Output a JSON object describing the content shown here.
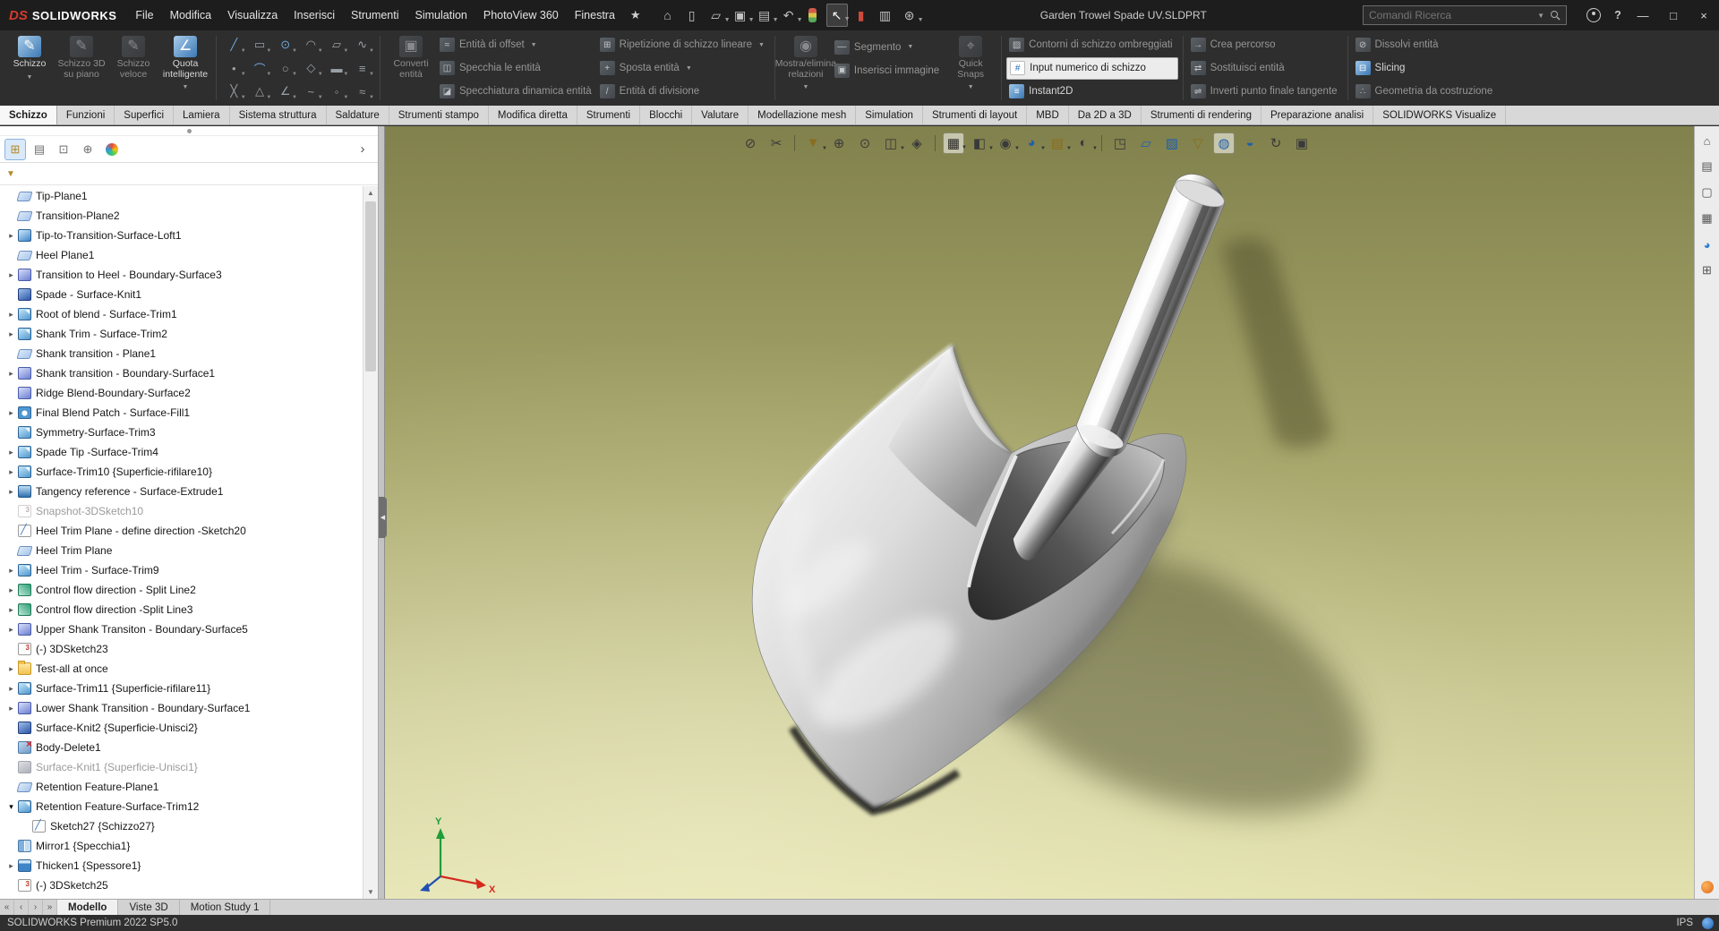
{
  "titlebar": {
    "logo_mark": "DS",
    "app_name": "SOLIDWORKS",
    "menus": [
      "File",
      "Modifica",
      "Visualizza",
      "Inserisci",
      "Strumenti",
      "Simulation",
      "PhotoView 360",
      "Finestra"
    ],
    "quick_icons": [
      {
        "name": "home-icon",
        "glyph": "⌂"
      },
      {
        "name": "new-document-icon",
        "glyph": "▯"
      },
      {
        "name": "open-icon",
        "glyph": "▱",
        "caret": true
      },
      {
        "name": "save-icon",
        "glyph": "▣",
        "caret": true
      },
      {
        "name": "print-icon",
        "glyph": "▤",
        "caret": true
      },
      {
        "name": "undo-icon",
        "glyph": "↶",
        "caret": true
      },
      {
        "name": "rebuild-icon",
        "glyph": "",
        "rebuild": true
      },
      {
        "name": "select-arrow-icon",
        "glyph": "↖",
        "pressed": true,
        "caret": true
      },
      {
        "name": "mate-icon",
        "glyph": "▮",
        "tone": "red"
      },
      {
        "name": "evaluate-icon",
        "glyph": "▥"
      },
      {
        "name": "options-gear-icon",
        "glyph": "⊛",
        "caret": true
      }
    ],
    "document_title": "Garden Trowel Spade UV.SLDPRT",
    "search_placeholder": "Comandi Ricerca",
    "window_buttons": {
      "minimize": "—",
      "maximize": "□",
      "close": "×"
    }
  },
  "ribbon": {
    "left_bigs": [
      {
        "label": "Schizzo",
        "name": "sketch-button",
        "icon_glyph": "✎",
        "state": "enabled",
        "caret": true
      },
      {
        "label": "Schizzo 3D su piano",
        "name": "sketch3d-on-plane-button",
        "icon_glyph": "✎",
        "state": "disabled"
      },
      {
        "label": "Schizzo veloce",
        "name": "rapid-sketch-button",
        "icon_glyph": "✎",
        "state": "disabled"
      },
      {
        "label": "Quota intelligente",
        "name": "smart-dimension-button",
        "icon_glyph": "∠",
        "state": "enabled",
        "caret": true
      }
    ],
    "sketch_tools": [
      {
        "name": "line-tool",
        "glyph": "╱",
        "tone": "blue",
        "caret": true
      },
      {
        "name": "corner-rectangle-tool",
        "glyph": "▭",
        "caret": true
      },
      {
        "name": "circle-tool",
        "glyph": "⊙",
        "tone": "blue",
        "caret": true
      },
      {
        "name": "centerpoint-arc-tool",
        "glyph": "◠",
        "caret": true
      },
      {
        "name": "polygon-tool",
        "glyph": "▱",
        "caret": true
      },
      {
        "name": "spline-tool",
        "glyph": "∿",
        "caret": true
      },
      {
        "name": "point-tool",
        "glyph": "•",
        "caret": true
      },
      {
        "name": "three-point-arc-tool",
        "glyph": "⌒",
        "tone": "blue",
        "caret": true
      },
      {
        "name": "ellipse-tool",
        "glyph": "○",
        "caret": true
      },
      {
        "name": "sketch-fillet-tool",
        "glyph": "◇",
        "caret": true
      },
      {
        "name": "straight-slot-tool",
        "glyph": "▬",
        "caret": true
      },
      {
        "name": "sketch-text-tool",
        "glyph": "≡",
        "caret": true
      },
      {
        "name": "centerline-tool",
        "glyph": "╳",
        "caret": true
      },
      {
        "name": "trim-tool",
        "glyph": "△",
        "caret": true
      },
      {
        "name": "extend-tool",
        "glyph": "∠",
        "caret": true
      },
      {
        "name": "construction-tool",
        "glyph": "~",
        "caret": true
      },
      {
        "name": "snap-tool",
        "glyph": "◦",
        "caret": true
      },
      {
        "name": "grid-tool",
        "glyph": "≈",
        "caret": true
      }
    ],
    "convert_bigs": [
      {
        "label": "Converti entità",
        "name": "convert-entities-button",
        "icon_glyph": "▣",
        "state": "disabled"
      }
    ],
    "col_a": [
      {
        "label": "Entità di offset",
        "name": "offset-entities-row",
        "glyph": "≈",
        "state": "disabled",
        "caret": true
      },
      {
        "label": "Specchia le entità",
        "name": "mirror-entities-row",
        "glyph": "◫",
        "state": "disabled"
      },
      {
        "label": "Specchiatura dinamica entità",
        "name": "dynamic-mirror-row",
        "glyph": "◪",
        "state": "disabled"
      }
    ],
    "col_b": [
      {
        "label": "Ripetizione di schizzo lineare",
        "name": "linear-sketch-pattern-row",
        "glyph": "⊞",
        "state": "disabled",
        "caret": true
      },
      {
        "label": "Sposta entità",
        "name": "move-entities-row",
        "glyph": "+",
        "state": "disabled",
        "caret": true
      },
      {
        "label": "Entità di divisione",
        "name": "split-entities-row",
        "glyph": "/",
        "state": "disabled"
      }
    ],
    "show_bigs": [
      {
        "label": "Mostra/elimina relazioni",
        "name": "display-delete-relations-button",
        "icon_glyph": "◉",
        "state": "disabled",
        "caret": true
      }
    ],
    "col_c": [
      {
        "label": "Segmento",
        "name": "segment-row",
        "glyph": "—",
        "state": "disabled",
        "caret": true
      },
      {
        "label": "Inserisci immagine",
        "name": "insert-image-row",
        "glyph": "▣",
        "state": "disabled"
      }
    ],
    "snap_bigs": [
      {
        "label": "Quick Snaps",
        "name": "quick-snaps-button",
        "icon_glyph": "⌖",
        "state": "disabled",
        "caret": true
      }
    ],
    "col_d": [
      {
        "label": "Contorni di schizzo ombreggiati",
        "name": "shaded-sketch-contours-row",
        "glyph": "▨",
        "state": "disabled"
      },
      {
        "label": "Input numerico di schizzo",
        "name": "sketch-numeric-input-row",
        "glyph": "#",
        "state": "highlight"
      },
      {
        "label": "Instant2D",
        "name": "instant2d-row",
        "glyph": "≡",
        "state": "enabled"
      }
    ],
    "col_e": [
      {
        "label": "Crea percorso",
        "name": "make-path-row",
        "glyph": "→",
        "state": "disabled"
      },
      {
        "label": "Sostituisci entità",
        "name": "replace-entity-row",
        "glyph": "⇄",
        "state": "disabled"
      },
      {
        "label": "Inverti punto finale tangente",
        "name": "reverse-tangent-row",
        "glyph": "⇌",
        "state": "disabled"
      }
    ],
    "col_f": [
      {
        "label": "Dissolvi entità",
        "name": "dissolve-entities-row",
        "glyph": "⊘",
        "state": "disabled"
      },
      {
        "label": "Slicing",
        "name": "slicing-row",
        "glyph": "⊟",
        "state": "enabled"
      },
      {
        "label": "Geometria da costruzione",
        "name": "construction-geometry-row",
        "glyph": "∴",
        "state": "disabled"
      }
    ]
  },
  "command_tabs": [
    {
      "label": "Schizzo",
      "active": true
    },
    {
      "label": "Funzioni"
    },
    {
      "label": "Superfici"
    },
    {
      "label": "Lamiera"
    },
    {
      "label": "Sistema struttura"
    },
    {
      "label": "Saldature"
    },
    {
      "label": "Strumenti stampo"
    },
    {
      "label": "Modifica diretta"
    },
    {
      "label": "Strumenti"
    },
    {
      "label": "Blocchi"
    },
    {
      "label": "Valutare"
    },
    {
      "label": "Modellazione mesh"
    },
    {
      "label": "Simulation"
    },
    {
      "label": "Strumenti di layout"
    },
    {
      "label": "MBD"
    },
    {
      "label": "Da 2D a 3D"
    },
    {
      "label": "Strumenti di rendering"
    },
    {
      "label": "Preparazione analisi"
    },
    {
      "label": "SOLIDWORKS Visualize"
    }
  ],
  "docwin_buttons": [
    "—",
    "◱",
    "×"
  ],
  "tree": {
    "items": [
      {
        "label": "Tip-Plane1",
        "icon": "plane"
      },
      {
        "label": "Transition-Plane2",
        "icon": "plane"
      },
      {
        "label": "Tip-to-Transition-Surface-Loft1",
        "icon": "surface-loft",
        "arrow": "collapsed"
      },
      {
        "label": "Heel Plane1",
        "icon": "plane"
      },
      {
        "label": "Transition to Heel - Boundary-Surface3",
        "icon": "boundary-surface",
        "arrow": "collapsed"
      },
      {
        "label": "Spade - Surface-Knit1",
        "icon": "surface-knit"
      },
      {
        "label": "Root of blend - Surface-Trim1",
        "icon": "surface-trim",
        "arrow": "collapsed"
      },
      {
        "label": "Shank Trim - Surface-Trim2",
        "icon": "surface-trim",
        "arrow": "collapsed"
      },
      {
        "label": "Shank transition - Plane1",
        "icon": "plane"
      },
      {
        "label": "Shank transition - Boundary-Surface1",
        "icon": "boundary-surface",
        "arrow": "collapsed"
      },
      {
        "label": "Ridge Blend-Boundary-Surface2",
        "icon": "boundary-surface"
      },
      {
        "label": "Final Blend Patch - Surface-Fill1",
        "icon": "surface-fill",
        "arrow": "collapsed"
      },
      {
        "label": "Symmetry-Surface-Trim3",
        "icon": "surface-trim"
      },
      {
        "label": "Spade Tip -Surface-Trim4",
        "icon": "surface-trim",
        "arrow": "collapsed"
      },
      {
        "label": "Surface-Trim10 {Superficie-rifilare10}",
        "icon": "surface-trim",
        "arrow": "collapsed"
      },
      {
        "label": "Tangency reference - Surface-Extrude1",
        "icon": "surface-extrude",
        "arrow": "collapsed"
      },
      {
        "label": "Snapshot-3DSketch10",
        "icon": "sketch3d",
        "state": "suppressed"
      },
      {
        "label": "Heel Trim Plane - define direction -Sketch20",
        "icon": "sketch"
      },
      {
        "label": "Heel Trim Plane",
        "icon": "plane"
      },
      {
        "label": "Heel Trim - Surface-Trim9",
        "icon": "surface-trim",
        "arrow": "collapsed"
      },
      {
        "label": "Control flow direction - Split Line2",
        "icon": "split-line",
        "arrow": "collapsed"
      },
      {
        "label": "Control flow direction -Split Line3",
        "icon": "split-line",
        "arrow": "collapsed"
      },
      {
        "label": "Upper Shank Transiton - Boundary-Surface5",
        "icon": "boundary-surface",
        "arrow": "collapsed"
      },
      {
        "label": "(-) 3DSketch23",
        "icon": "sketch3d"
      },
      {
        "label": "Test-all at once",
        "icon": "folder",
        "arrow": "collapsed"
      },
      {
        "label": "Surface-Trim11 {Superficie-rifilare11}",
        "icon": "surface-trim",
        "arrow": "collapsed"
      },
      {
        "label": "Lower Shank Transition - Boundary-Surface1",
        "icon": "boundary-surface",
        "arrow": "collapsed"
      },
      {
        "label": "Surface-Knit2 {Superficie-Unisci2}",
        "icon": "surface-knit"
      },
      {
        "label": "Body-Delete1",
        "icon": "body-delete"
      },
      {
        "label": "Surface-Knit1 {Superficie-Unisci1}",
        "icon": "surface-knit",
        "state": "suppressed"
      },
      {
        "label": "Retention Feature-Plane1",
        "icon": "plane"
      },
      {
        "label": "Retention Feature-Surface-Trim12",
        "icon": "surface-trim",
        "arrow": "expanded"
      },
      {
        "label": "Sketch27 {Schizzo27}",
        "icon": "sketch",
        "indent": 1
      },
      {
        "label": "Mirror1 {Specchia1}",
        "icon": "mirror"
      },
      {
        "label": "Thicken1 {Spessore1}",
        "icon": "thicken",
        "arrow": "collapsed"
      },
      {
        "label": "(-) 3DSketch25",
        "icon": "sketch3d"
      }
    ]
  },
  "viewport": {
    "toolbar": [
      {
        "name": "no-snap-icon",
        "glyph": "⊘",
        "tone": "dim"
      },
      {
        "name": "scissors-icon",
        "glyph": "✂",
        "tone": "dim"
      },
      {
        "sep": true
      },
      {
        "name": "filter-display-icon",
        "glyph": "▼",
        "tone": "gold",
        "caret": true
      },
      {
        "name": "zoom-fit-icon",
        "glyph": "⊕",
        "tone": "dim"
      },
      {
        "name": "zoom-area-icon",
        "glyph": "⊙",
        "tone": "dim"
      },
      {
        "name": "section-view-icon",
        "glyph": "◫",
        "tone": "dim",
        "caret": true
      },
      {
        "name": "dynamic-annotation-icon",
        "glyph": "◈",
        "tone": "dim"
      },
      {
        "sep": true
      },
      {
        "name": "view-orientation-icon",
        "glyph": "▦",
        "tone": "dark",
        "active": true,
        "caret": true
      },
      {
        "name": "display-style-icon",
        "glyph": "◧",
        "tone": "dim",
        "caret": true
      },
      {
        "name": "hide-show-items-icon",
        "glyph": "◉",
        "tone": "dim",
        "caret": true
      },
      {
        "name": "edit-appearance-icon",
        "glyph": "◕",
        "tone": "blue",
        "caret": true
      },
      {
        "name": "apply-scene-icon",
        "glyph": "▤",
        "tone": "gold",
        "caret": true
      },
      {
        "name": "view-settings-icon",
        "glyph": "◐",
        "tone": "dim",
        "caret": true
      },
      {
        "sep": true
      },
      {
        "name": "instant3d-icon",
        "glyph": "◳",
        "tone": "dim"
      },
      {
        "name": "plane-display-icon",
        "glyph": "▱",
        "tone": "blue"
      },
      {
        "name": "gradient-background-icon",
        "glyph": "▨",
        "tone": "blue"
      },
      {
        "name": "funnel-icon",
        "glyph": "▽",
        "tone": "gold"
      },
      {
        "name": "realview-icon",
        "glyph": "◍",
        "tone": "blue",
        "active": true
      },
      {
        "name": "shadows-icon",
        "glyph": "◒",
        "tone": "blue"
      },
      {
        "name": "rotate-view-icon",
        "glyph": "↻",
        "tone": "dim"
      },
      {
        "name": "camera-icon",
        "glyph": "▣",
        "tone": "dim"
      }
    ],
    "triad": {
      "x": "X",
      "y": "Y"
    }
  },
  "taskpane": {
    "icons": [
      {
        "name": "home-icon",
        "glyph": "⌂"
      },
      {
        "name": "design-library-icon",
        "glyph": "▤"
      },
      {
        "name": "file-explorer-icon",
        "glyph": "▢"
      },
      {
        "name": "view-palette-icon",
        "glyph": "▦"
      },
      {
        "name": "appearances-icon",
        "glyph": "◕",
        "tone": "color"
      },
      {
        "name": "custom-properties-icon",
        "glyph": "⊞"
      }
    ]
  },
  "doc_tabs": {
    "nav": [
      {
        "name": "scroll-first-icon",
        "glyph": "«"
      },
      {
        "name": "scroll-prev-icon",
        "glyph": "‹"
      },
      {
        "name": "scroll-next-icon",
        "glyph": "›"
      },
      {
        "name": "scroll-last-icon",
        "glyph": "»"
      }
    ],
    "items": [
      {
        "label": "Modello",
        "active": true
      },
      {
        "label": "Viste 3D"
      },
      {
        "label": "Motion Study 1"
      }
    ]
  },
  "statusbar": {
    "message": "SOLIDWORKS Premium 2022 SP5.0",
    "units": "IPS"
  }
}
